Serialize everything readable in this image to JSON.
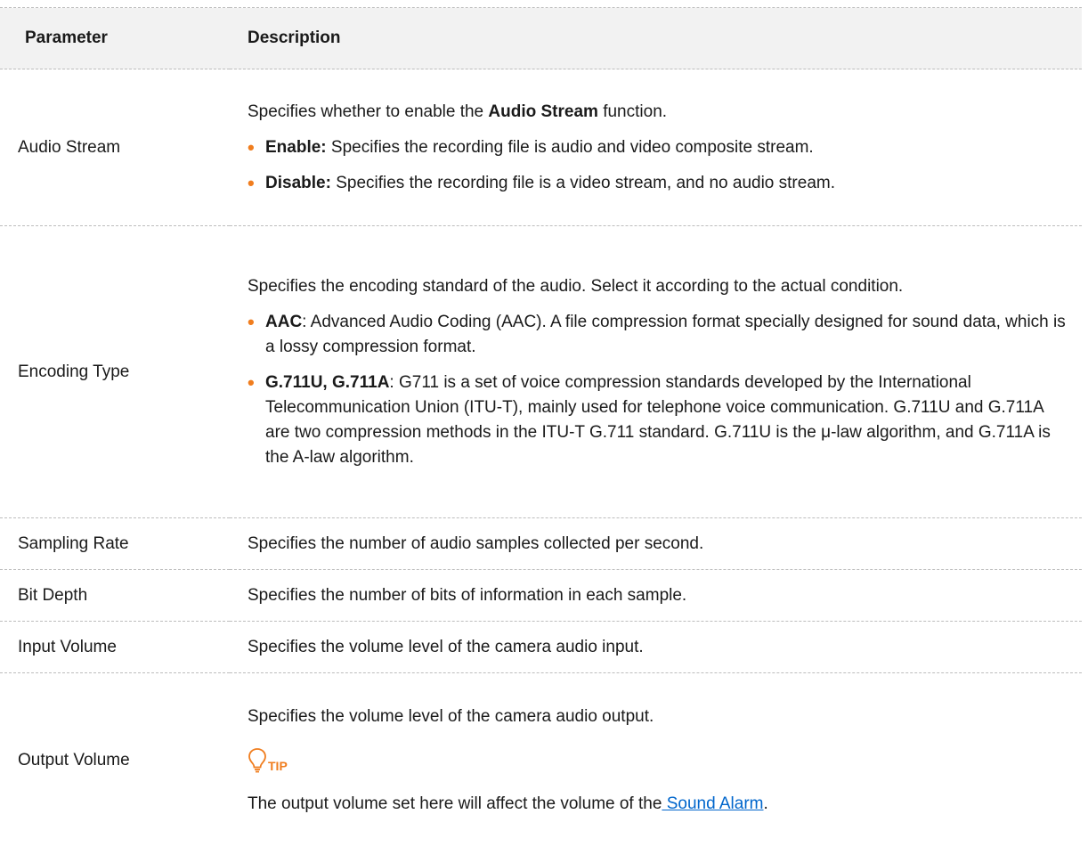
{
  "table": {
    "header": {
      "parameter": "Parameter",
      "description": "Description"
    },
    "rows": [
      {
        "param": "Audio Stream",
        "intro_pre": "Specifies whether to enable the ",
        "intro_bold": "Audio Stream",
        "intro_post": " function.",
        "bullets": [
          {
            "term": "Enable:",
            "text": " Specifies the recording file is audio and video composite stream."
          },
          {
            "term": "Disable:",
            "text": " Specifies the recording file is a video stream, and no audio stream."
          }
        ]
      },
      {
        "param": "Encoding Type",
        "intro": "Specifies the encoding standard of the audio. Select it according to the actual condition.",
        "bullets": [
          {
            "term": "AAC",
            "text": ": Advanced Audio Coding (AAC). A file compression format specially designed for sound data, which is a lossy compression format."
          },
          {
            "term": "G.711U, G.711A",
            "text": ": G711 is a set of voice compression standards developed by the International Telecommunication Union (ITU-T), mainly used for telephone voice communication. G.711U and G.711A are two compression methods in the ITU-T G.711 standard. G.711U is the μ-law algorithm, and G.711A is the A-law algorithm."
          }
        ]
      },
      {
        "param": "Sampling Rate",
        "description": "Specifies the number of audio samples collected per second."
      },
      {
        "param": "Bit Depth",
        "description": "Specifies the number of bits of information in each sample."
      },
      {
        "param": "Input Volume",
        "description": "Specifies the volume level of the camera audio input."
      },
      {
        "param": "Output Volume",
        "description": "Specifies the volume level of the camera audio output.",
        "tip_label": "TIP",
        "tip_text_pre": "The output volume set here will affect the volume of the",
        "tip_link": " Sound Alarm",
        "tip_text_post": "."
      }
    ]
  },
  "icons": {
    "bullet": "bullet-dot",
    "tip": "lightbulb-icon"
  },
  "colors": {
    "accent": "#f07d1e",
    "link": "#0066cc",
    "header_bg": "#f2f2f2"
  }
}
